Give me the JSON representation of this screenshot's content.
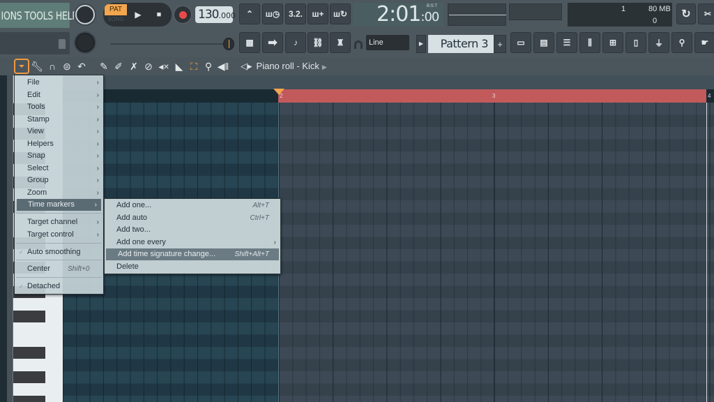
{
  "app": {
    "menu_strip": "IONS TOOLS HELP",
    "transport": {
      "pat_label": "PAT",
      "song_label": "SONG",
      "play_icon": "play-icon",
      "stop_icon": "stop-icon",
      "record_icon": "record-icon",
      "tempo_whole": "130",
      "tempo_fraction": ".000"
    },
    "clock": {
      "time": "2:01",
      "sub": ":00",
      "label": "B:S:T"
    },
    "cpu": {
      "polyphony": "1",
      "memory": "80 MB",
      "value2": "0"
    },
    "snap_mode": "Line",
    "pattern": "Pattern 3",
    "pattern_add": "+",
    "toolbar_row1": [
      "metronome-icon",
      "wait-for-input-icon",
      "countdown-icon",
      "blend-recording-icon",
      "loop-record-icon"
    ],
    "toolbar_row2": [
      "typing-keyboard-icon",
      "step-edit-icon",
      "scrub-icon",
      "link-icon",
      "master-volume-icon"
    ],
    "window_buttons": [
      "playlist-icon",
      "piano-roll-icon",
      "channel-rack-icon",
      "mixer-icon",
      "browser-icon",
      "project-notes-icon",
      "plugin-database-icon",
      "touch-controller-icon",
      "help-pointer-icon"
    ]
  },
  "piano_roll": {
    "title": "Piano roll - Kick",
    "tools": [
      "wrench-icon",
      "magnet-icon",
      "stop-circle-icon",
      "undo-icon",
      "pencil-icon",
      "paint-icon",
      "delete-icon",
      "mute-icon",
      "slice-icon",
      "select-icon",
      "zoom-icon",
      "playback-icon"
    ],
    "ruler": {
      "bars": [
        "2",
        "3",
        "4"
      ]
    }
  },
  "context_menu": {
    "items": [
      {
        "label": "File",
        "submenu": true
      },
      {
        "label": "Edit",
        "submenu": true
      },
      {
        "label": "Tools",
        "submenu": true
      },
      {
        "label": "Stamp",
        "submenu": true
      },
      {
        "label": "View",
        "submenu": true
      },
      {
        "label": "Helpers",
        "submenu": true
      },
      {
        "label": "Snap",
        "submenu": true
      },
      {
        "label": "Select",
        "submenu": true
      },
      {
        "label": "Group",
        "submenu": true
      },
      {
        "label": "Zoom",
        "submenu": true
      },
      {
        "label": "Time markers",
        "submenu": true,
        "active": true
      },
      {
        "label": "Target channel",
        "submenu": true
      },
      {
        "label": "Target control",
        "submenu": true
      },
      {
        "label": "Auto smoothing",
        "checked": true
      },
      {
        "label": "Center",
        "shortcut": "Shift+0"
      },
      {
        "label": "Detached",
        "checked": true
      }
    ]
  },
  "time_markers_submenu": {
    "items": [
      {
        "label": "Add one...",
        "shortcut": "Alt+T"
      },
      {
        "label": "Add auto",
        "shortcut": "Ctrl+T"
      },
      {
        "label": "Add two..."
      },
      {
        "label": "Add one every",
        "submenu": true
      },
      {
        "label": "Add time signature change...",
        "shortcut": "Shift+Alt+T",
        "active": true
      },
      {
        "label": "Delete"
      }
    ]
  }
}
